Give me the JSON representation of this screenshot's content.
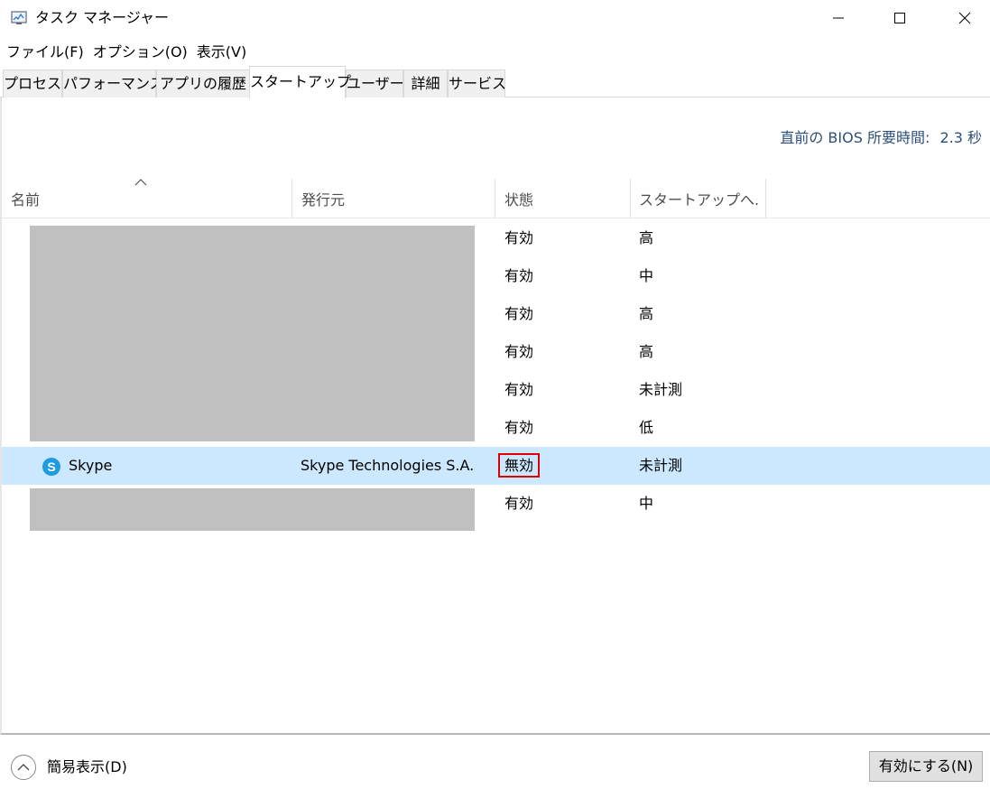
{
  "window": {
    "title": "タスク マネージャー",
    "icon": "task-manager-icon",
    "controls": {
      "minimize": "minimize-icon",
      "maximize": "maximize-icon",
      "close": "close-icon"
    }
  },
  "menu": [
    "ファイル(F)",
    "オプション(O)",
    "表示(V)"
  ],
  "tabs": [
    "プロセス",
    "パフォーマンス",
    "アプリの履歴",
    "スタートアップ",
    "ユーザー",
    "詳細",
    "サービス"
  ],
  "active_tab": "スタートアップ",
  "bios": {
    "label": "直前の BIOS 所要時間:",
    "value": "2.3 秒"
  },
  "columns": [
    "名前",
    "発行元",
    "状態",
    "スタートアップへ..."
  ],
  "sort_icon": "sort-ascending-icon",
  "rows": [
    {
      "name": "",
      "publisher": "",
      "status": "有効",
      "impact": "高",
      "redacted": true
    },
    {
      "name": "",
      "publisher": "",
      "status": "有効",
      "impact": "中",
      "redacted": true
    },
    {
      "name": "",
      "publisher": "",
      "status": "有効",
      "impact": "高",
      "redacted": true
    },
    {
      "name": "",
      "publisher": "",
      "status": "有効",
      "impact": "高",
      "redacted": true
    },
    {
      "name": "",
      "publisher": "",
      "status": "有効",
      "impact": "未計測",
      "redacted": true
    },
    {
      "name": "",
      "publisher": "",
      "status": "有効",
      "impact": "低",
      "redacted": true
    },
    {
      "name": "Skype",
      "publisher": "Skype Technologies S.A.",
      "status": "無効",
      "impact": "未計測",
      "icon": "skype-icon",
      "selected": true,
      "status_highlighted": true
    },
    {
      "name": "",
      "publisher": "",
      "status": "有効",
      "impact": "中",
      "redacted": true
    }
  ],
  "colors": {
    "selection": "#cce8ff",
    "highlight_border": "#e00000",
    "bios_text": "#2b4f7a"
  },
  "footer": {
    "fewer_details": "簡易表示(D)",
    "fewer_icon": "chevron-up-icon",
    "enable_button": "有効にする(N)"
  }
}
